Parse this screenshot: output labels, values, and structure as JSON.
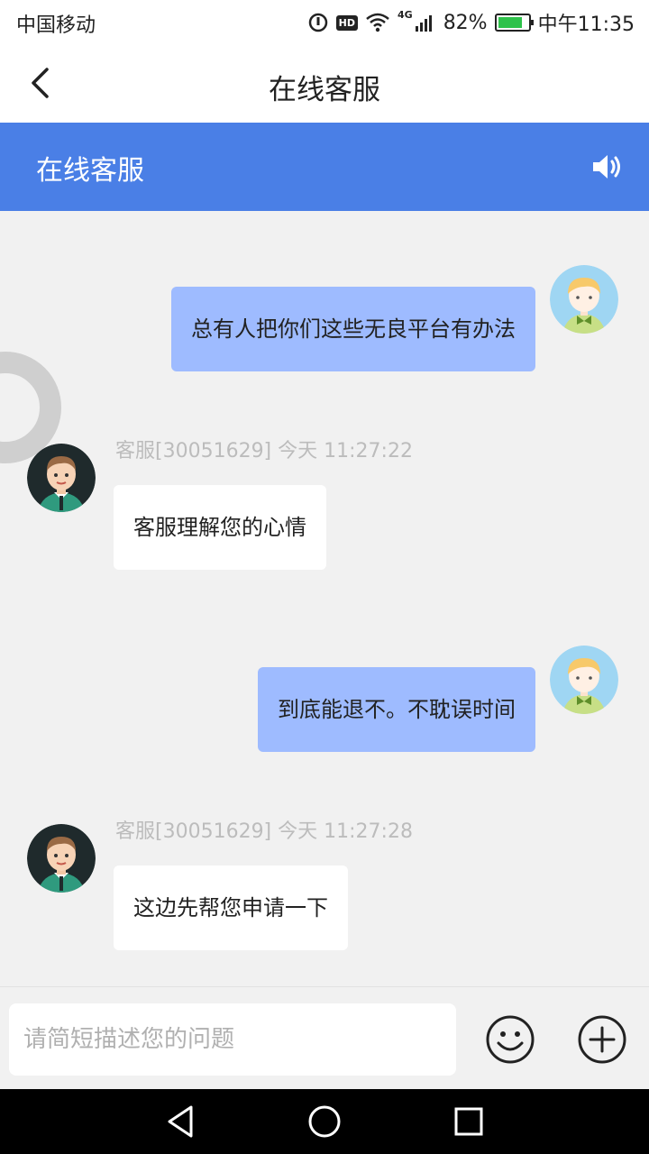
{
  "status_bar": {
    "carrier": "中国移动",
    "hd": "HD",
    "network": "4G",
    "battery": "82%",
    "battery_level": 0.82,
    "time": "中午11:35"
  },
  "nav": {
    "title": "在线客服",
    "back_icon": "chevron-left-icon"
  },
  "header": {
    "title": "在线客服",
    "speaker_icon": "speaker-icon",
    "color": "#4a7fe6"
  },
  "messages": [
    {
      "from": "user",
      "text": "总有人把你们这些无良平台有办法"
    },
    {
      "from": "agent",
      "meta": "客服[30051629]  今天 11:27:22",
      "text": "客服理解您的心情"
    },
    {
      "from": "user",
      "text": "到底能退不。不耽误时间"
    },
    {
      "from": "agent",
      "meta": "客服[30051629]  今天 11:27:28",
      "text": "这边先帮您申请一下"
    }
  ],
  "input": {
    "placeholder": "请简短描述您的问题",
    "emoji_icon": "smiley-icon",
    "plus_icon": "plus-circle-icon"
  },
  "colors": {
    "user_bubble": "#9ebbff",
    "agent_bubble": "#ffffff",
    "chat_bg": "#f1f1f1"
  }
}
